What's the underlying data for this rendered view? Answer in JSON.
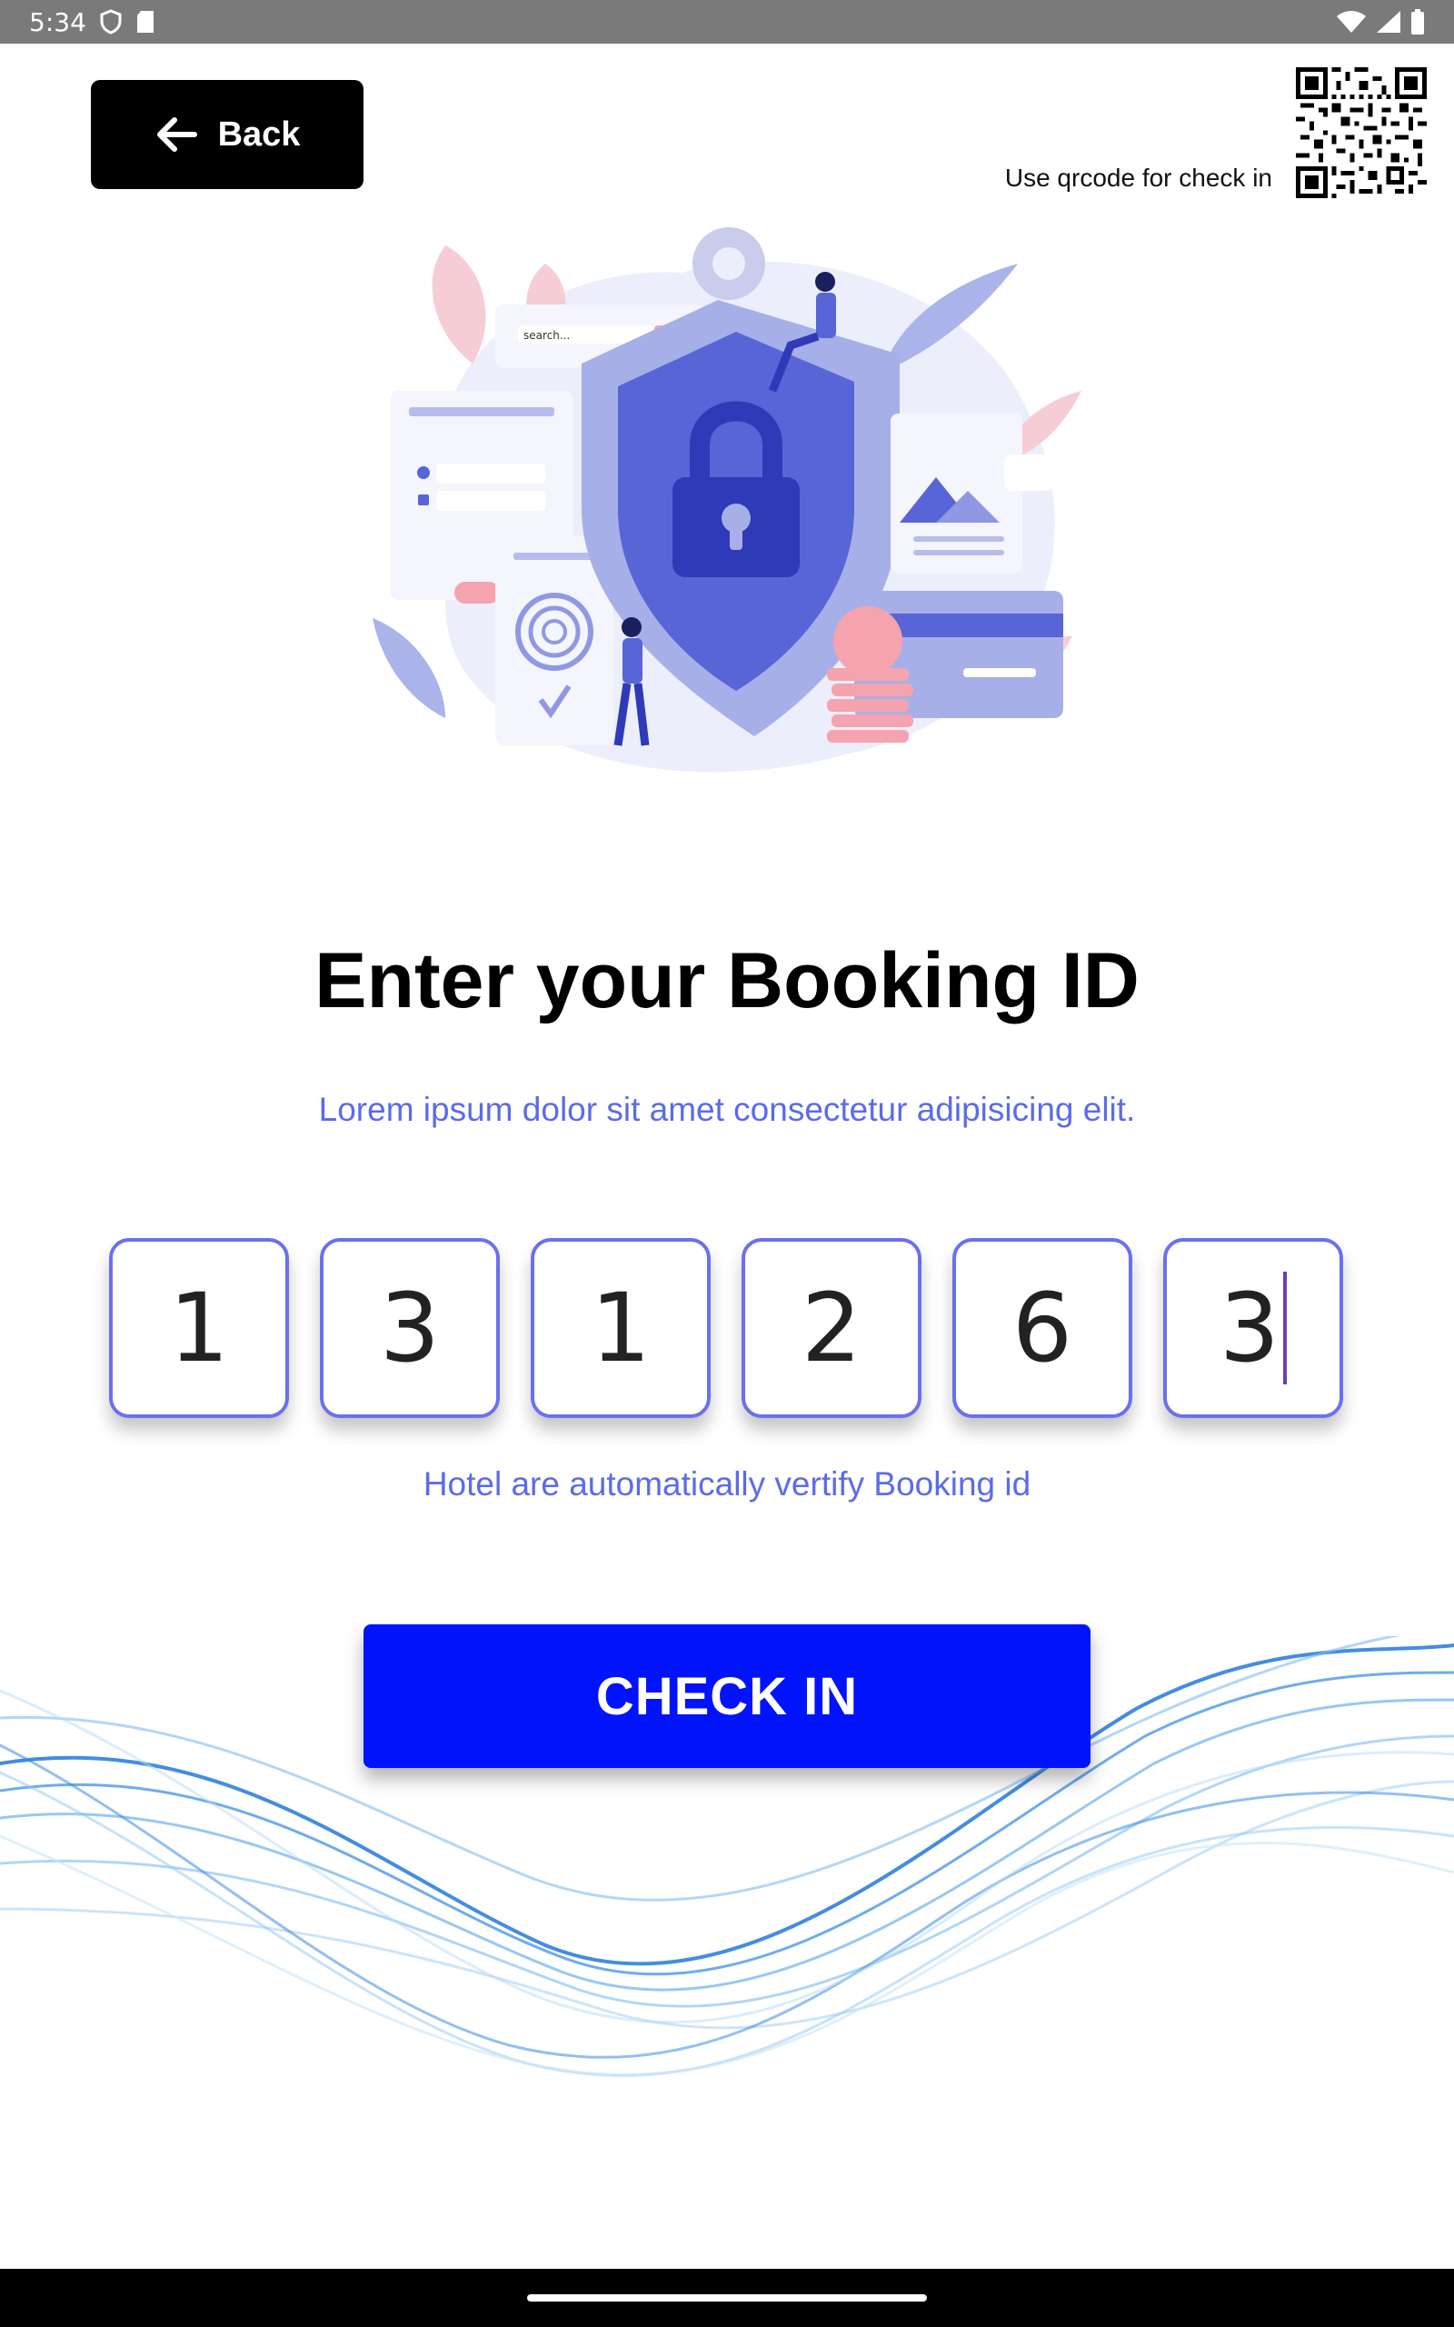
{
  "status_bar": {
    "time": "5:34"
  },
  "header": {
    "back_label": "Back",
    "qr_caption": "Use qrcode for check in"
  },
  "main": {
    "title": "Enter your Booking ID",
    "subtitle": "Lorem ipsum dolor sit amet consectetur adipisicing elit.",
    "booking_digits": [
      "1",
      "3",
      "1",
      "2",
      "6",
      "3"
    ],
    "hint": "Hotel are automatically vertify Booking id",
    "illustration_search_text": "search...",
    "checkin_label": "CHECK IN"
  },
  "colors": {
    "accent": "#0013fb",
    "link": "#5b6bea",
    "otp_border": "#6a70ee"
  },
  "icons": [
    "shield-status-icon",
    "sd-card-icon",
    "wifi-icon",
    "signal-icon",
    "battery-icon",
    "arrow-left-icon",
    "qr-code-icon"
  ]
}
